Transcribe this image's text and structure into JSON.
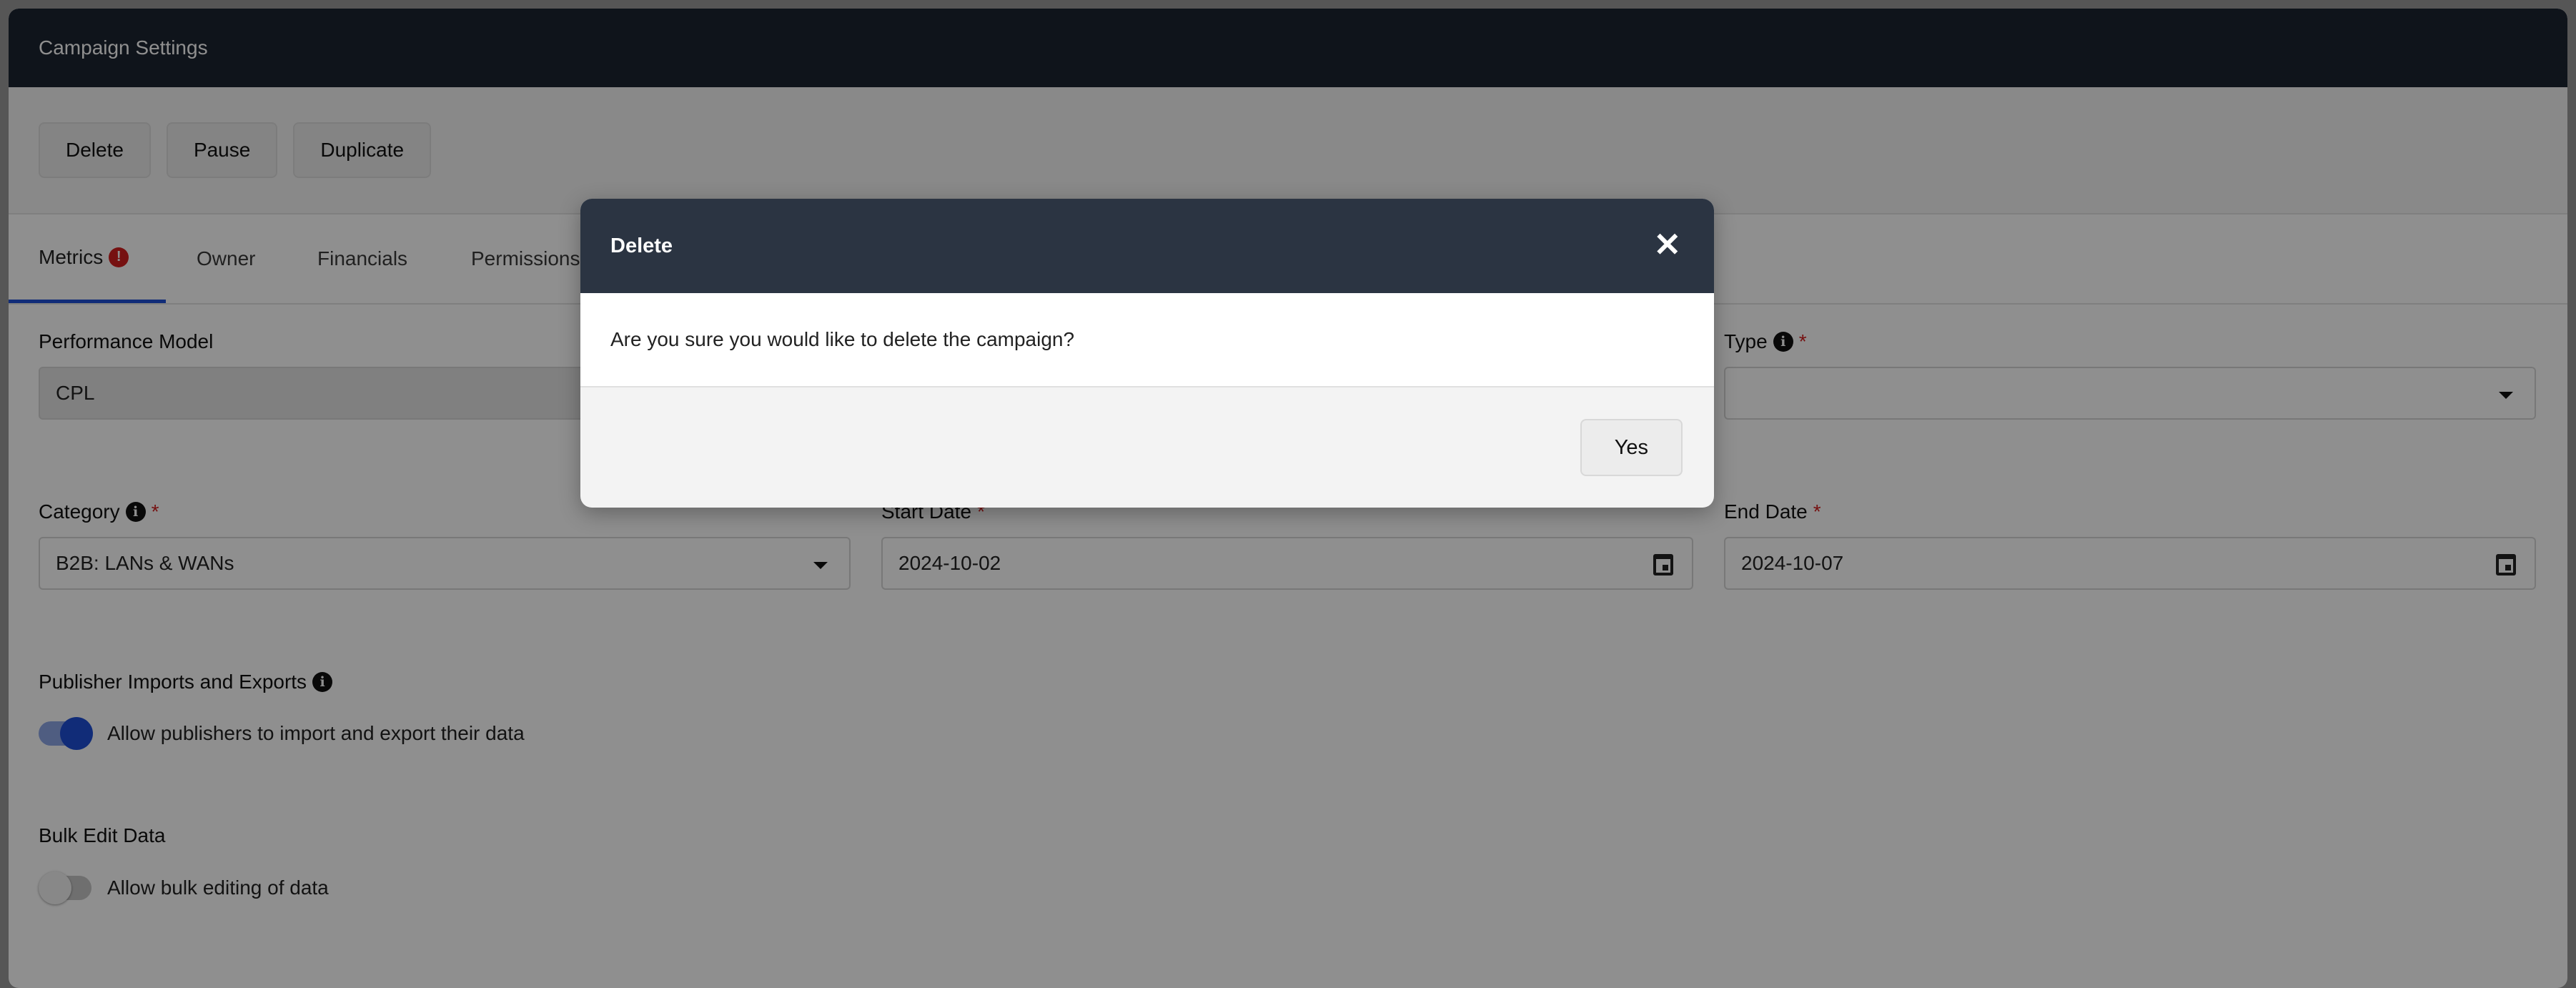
{
  "app": {
    "title": "Campaign Settings"
  },
  "toolbar": {
    "delete_label": "Delete",
    "pause_label": "Pause",
    "duplicate_label": "Duplicate"
  },
  "tabs": [
    {
      "label": "Metrics",
      "active": true,
      "alert": "!"
    },
    {
      "label": "Owner"
    },
    {
      "label": "Financials"
    },
    {
      "label": "Permissions"
    }
  ],
  "form": {
    "performance_model": {
      "label": "Performance Model",
      "value": "CPL"
    },
    "type": {
      "label": "Type",
      "required_mark": "*",
      "value": ""
    },
    "category": {
      "label": "Category",
      "required_mark": "*",
      "value": "B2B: LANs & WANs"
    },
    "start_date": {
      "label": "Start Date",
      "required_mark": "*",
      "value": "2024-10-02"
    },
    "end_date": {
      "label": "End Date",
      "required_mark": "*",
      "value": "2024-10-07"
    },
    "publisher_imports": {
      "label": "Publisher Imports and Exports",
      "toggle_label": "Allow publishers to import and export their data",
      "enabled": true
    },
    "bulk_edit": {
      "label": "Bulk Edit Data",
      "toggle_label": "Allow bulk editing of data",
      "enabled": false
    }
  },
  "modal": {
    "title": "Delete",
    "close_glyph": "✕",
    "message": "Are you sure you would like to delete the campaign?",
    "confirm_label": "Yes"
  },
  "colors": {
    "header_bg": "#1c2431",
    "accent": "#1f4fd6",
    "required": "#d21f1f",
    "modal_header": "#2b3442"
  },
  "icons": {
    "info": "info-icon",
    "calendar": "calendar-icon",
    "dropdown": "chevron-down-icon",
    "close": "close-icon",
    "alert": "alert-icon"
  }
}
